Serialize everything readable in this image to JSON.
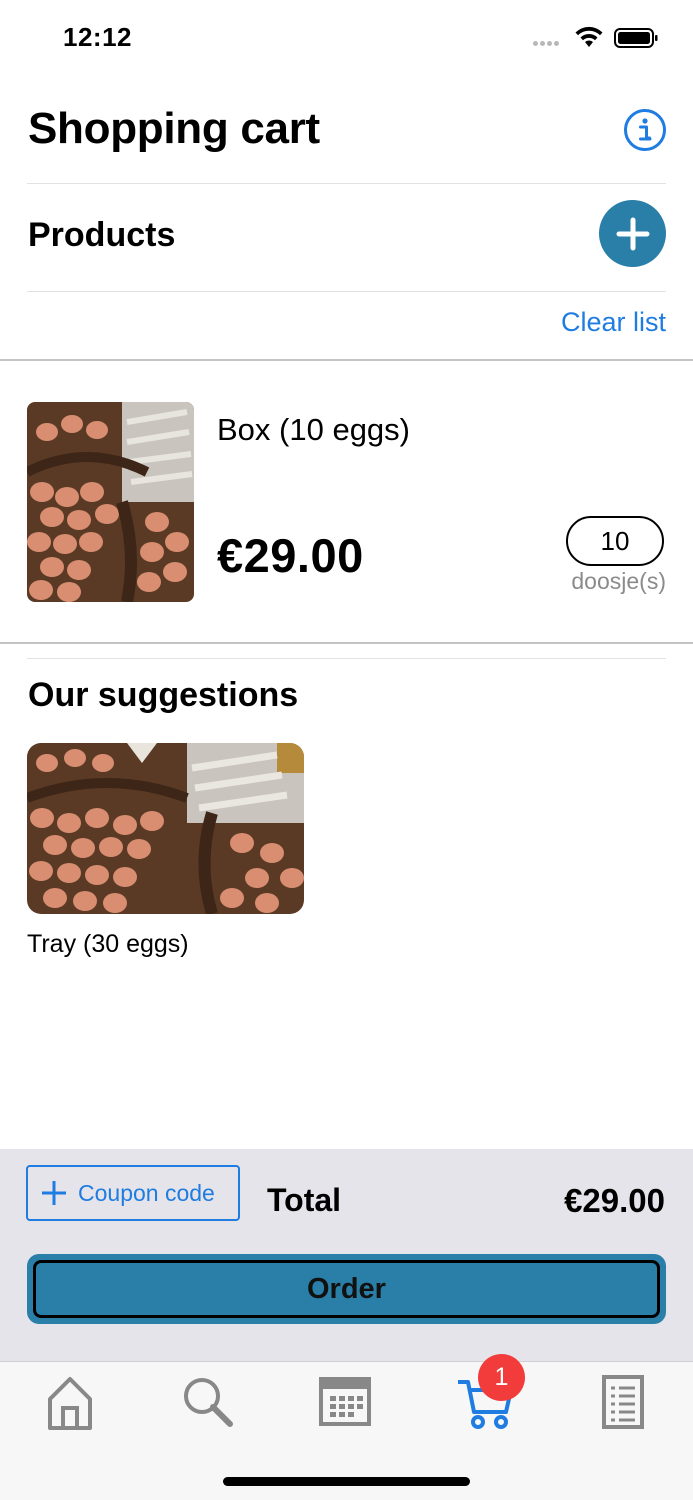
{
  "status_bar": {
    "time": "12:12"
  },
  "header": {
    "title": "Shopping cart",
    "info_icon": "info-circle-icon"
  },
  "products": {
    "title": "Products",
    "add_icon": "plus-icon",
    "clear_label": "Clear list"
  },
  "cart_items": [
    {
      "name": "Box (10 eggs)",
      "price": "€29.00",
      "quantity": "10",
      "unit": "doosje(s)",
      "image": "eggs-photo"
    }
  ],
  "suggestions": {
    "title": "Our suggestions",
    "items": [
      {
        "name": "Tray (30 eggs)",
        "image": "eggs-photo"
      }
    ]
  },
  "footer": {
    "coupon_label": "Coupon code",
    "total_label": "Total",
    "total_value": "€29.00",
    "order_label": "Order"
  },
  "tab_bar": {
    "tabs": [
      {
        "name": "home",
        "icon": "home-icon"
      },
      {
        "name": "search",
        "icon": "search-icon"
      },
      {
        "name": "calendar",
        "icon": "calendar-icon"
      },
      {
        "name": "cart",
        "icon": "cart-icon",
        "active": true
      },
      {
        "name": "orders",
        "icon": "list-icon"
      }
    ],
    "cart_badge": "1"
  },
  "colors": {
    "accent": "#1f7ce0",
    "primary_button": "#2a7fa8",
    "badge": "#f23c3c",
    "footer_bg": "#e4e4ea"
  }
}
